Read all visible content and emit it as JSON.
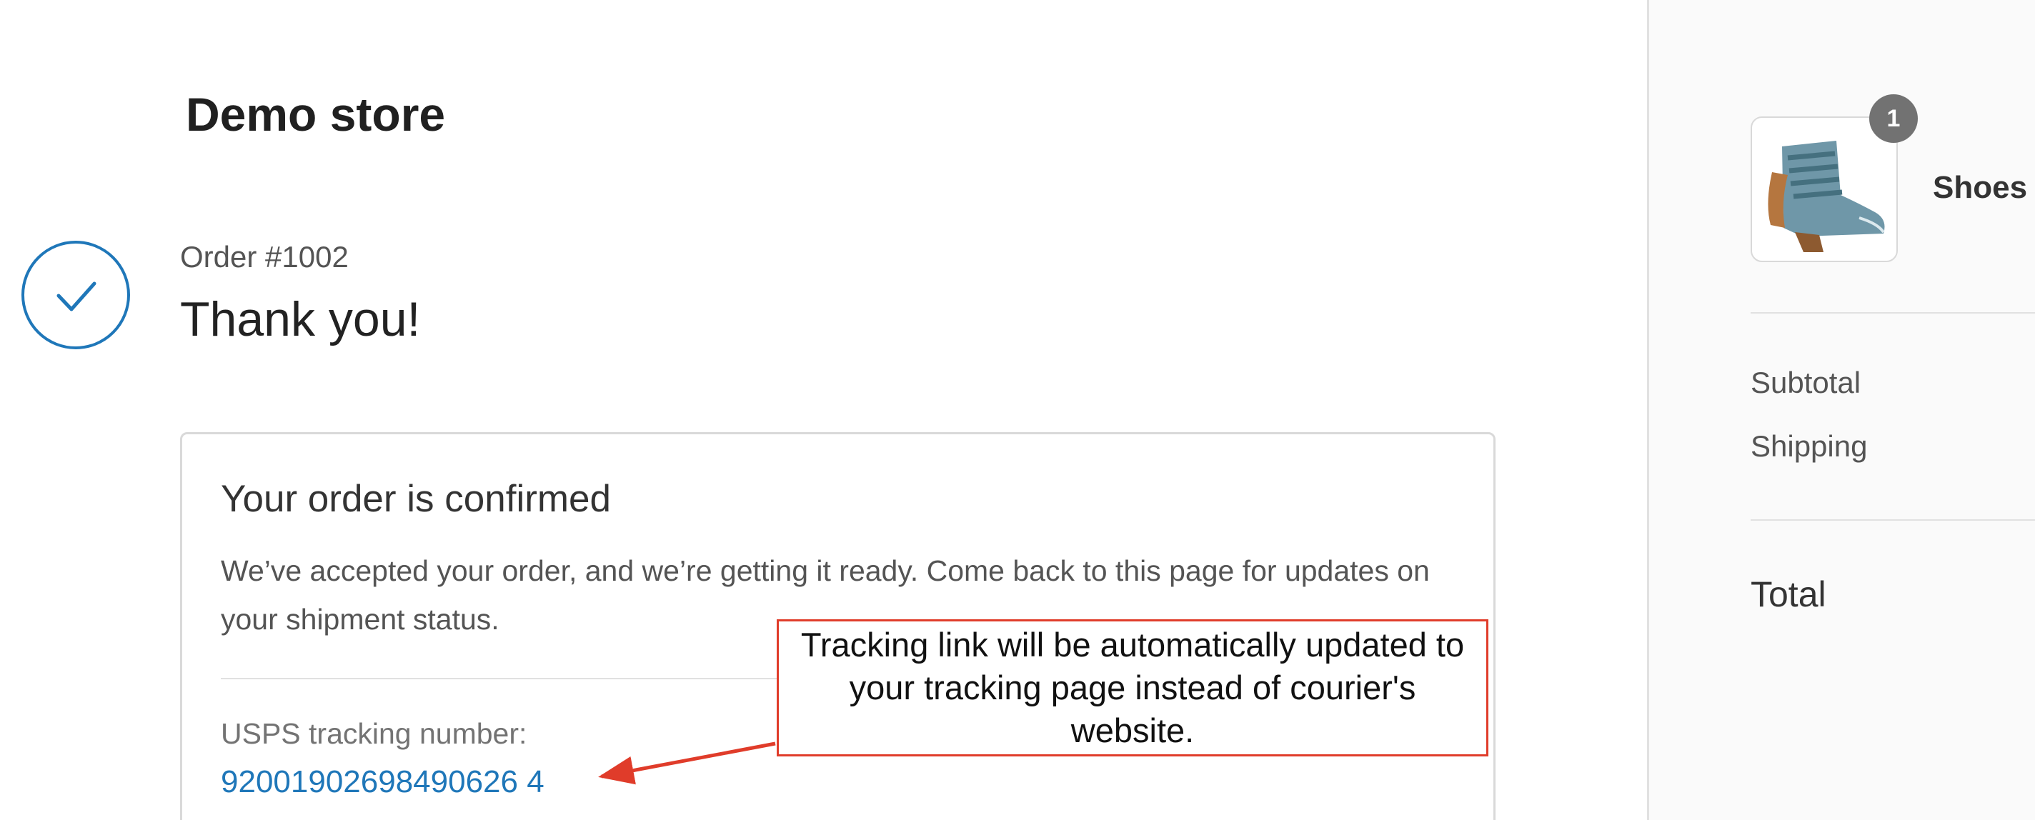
{
  "header": {
    "store_name": "Demo store"
  },
  "order": {
    "number_label": "Order #1002",
    "thank_you": "Thank you!"
  },
  "confirmation": {
    "title": "Your order is confirmed",
    "body": "We’ve accepted your order, and we’re getting it ready. Come back to this page for updates on your shipment status.",
    "tracking_label": "USPS tracking number:",
    "tracking_number": "92001902698490626 4"
  },
  "annotation": {
    "text": "Tracking link will be automatically updated to your tracking page instead of courier's website.",
    "color": "#e03c2a"
  },
  "sidebar": {
    "product": {
      "name": "Shoes",
      "quantity": "1",
      "icon": "boot-image"
    },
    "summary": {
      "subtotal_label": "Subtotal",
      "shipping_label": "Shipping",
      "total_label": "Total"
    }
  },
  "colors": {
    "accent": "#1f77b9",
    "annotation": "#e03c2a",
    "sidebar_bg": "#fafafa"
  }
}
